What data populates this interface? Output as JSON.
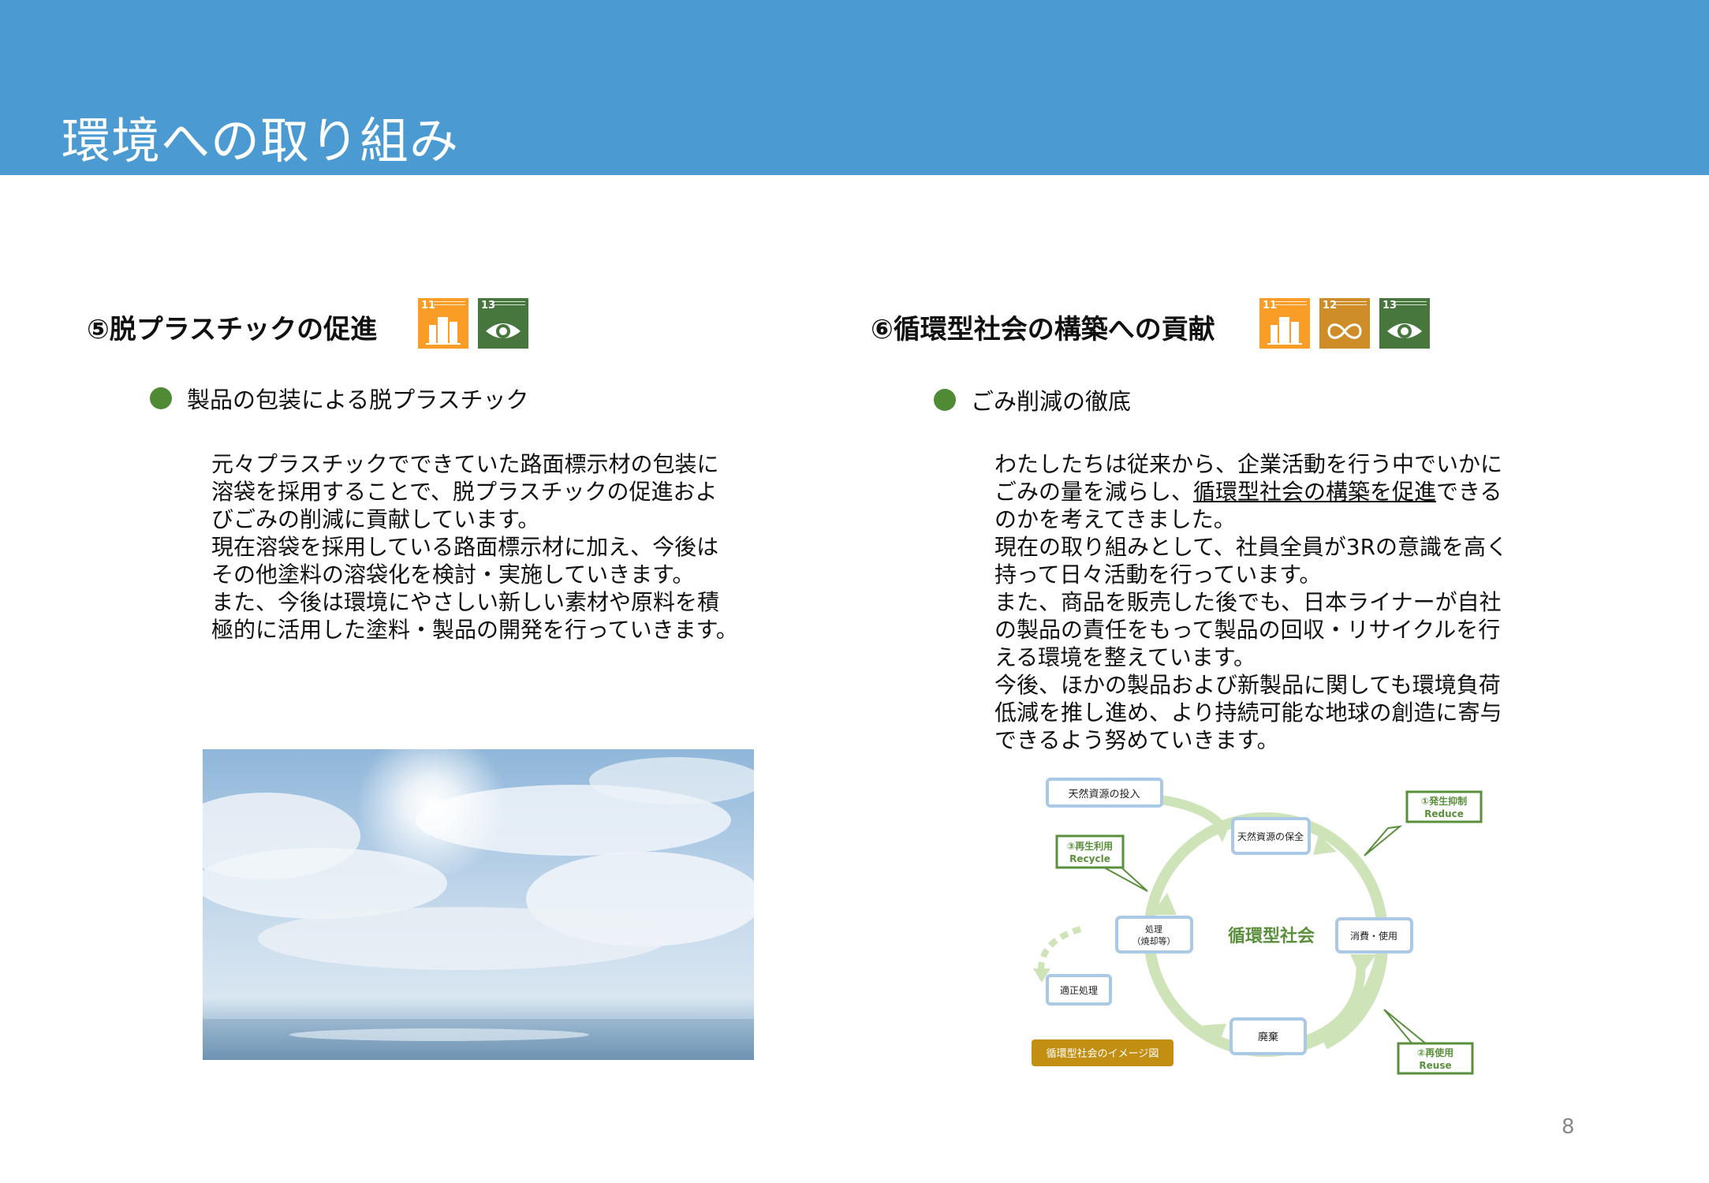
{
  "header": {
    "title": "環境への取り組み"
  },
  "left": {
    "title": "⑤脱プラスチックの促進",
    "sdg_badges": [
      {
        "num": "11"
      },
      {
        "num": "13"
      }
    ],
    "bullet": "製品の包装による脱プラスチック",
    "paragraph_lines": [
      "元々プラスチックでできていた路面標示材の包装に",
      "溶袋を採用することで、脱プラスチックの促進およ",
      "びごみの削減に貢献しています。",
      "現在溶袋を採用している路面標示材に加え、今後は",
      "その他塗料の溶袋化を検討・実施していきます。",
      "また、今後は環境にやさしい新しい素材や原料を積",
      "極的に活用した塗料・製品の開発を行っていきます。"
    ]
  },
  "right": {
    "title": "⑥循環型社会の構築への貢献",
    "sdg_badges": [
      {
        "num": "11"
      },
      {
        "num": "12"
      },
      {
        "num": "13"
      }
    ],
    "bullet": "ごみ削減の徹底",
    "paragraph": {
      "l1": "わたしたちは従来から、企業活動を行う中でいかに",
      "l2a": "ごみの量を減らし、",
      "l2u": "循環型社会の構築を促進",
      "l2b": "できる",
      "l3": "のかを考えてきました。",
      "l4": "現在の取り組みとして、社員全員が3Rの意識を高く",
      "l5": "持って日々活動を行っています。",
      "l6": "また、商品を販売した後でも、日本ライナーが自社",
      "l7": "の製品の責任をもって製品の回収・リサイクルを行",
      "l8": "える環境を整えています。",
      "l9": "今後、ほかの製品および新製品に関しても環境負荷",
      "l10": "低減を推し進め、より持続可能な地球の創造に寄与",
      "l11": "できるよう努めていきます。"
    }
  },
  "diagram": {
    "center": "循環型社会",
    "input": "天然資源の投入",
    "conserve": "天然資源の保全",
    "consume": "消費・使用",
    "dispose": "廃棄",
    "treat_l1": "処理",
    "treat_l2": "（焼却等）",
    "proper": "適正処理",
    "reduce_l1": "①発生抑制",
    "reduce_l2": "Reduce",
    "reuse_l1": "②再使用",
    "reuse_l2": "Reuse",
    "recycle_l1": "③再生利用",
    "recycle_l2": "Recycle",
    "caption": "循環型社会のイメージ図"
  },
  "page_number": "8",
  "colors": {
    "header": "#4b9bd2",
    "bullet": "#4f8a34",
    "diagram_green": "#5a8f3c",
    "diagram_box_border": "#a9c9e6",
    "caption_bg": "#c38f13"
  }
}
